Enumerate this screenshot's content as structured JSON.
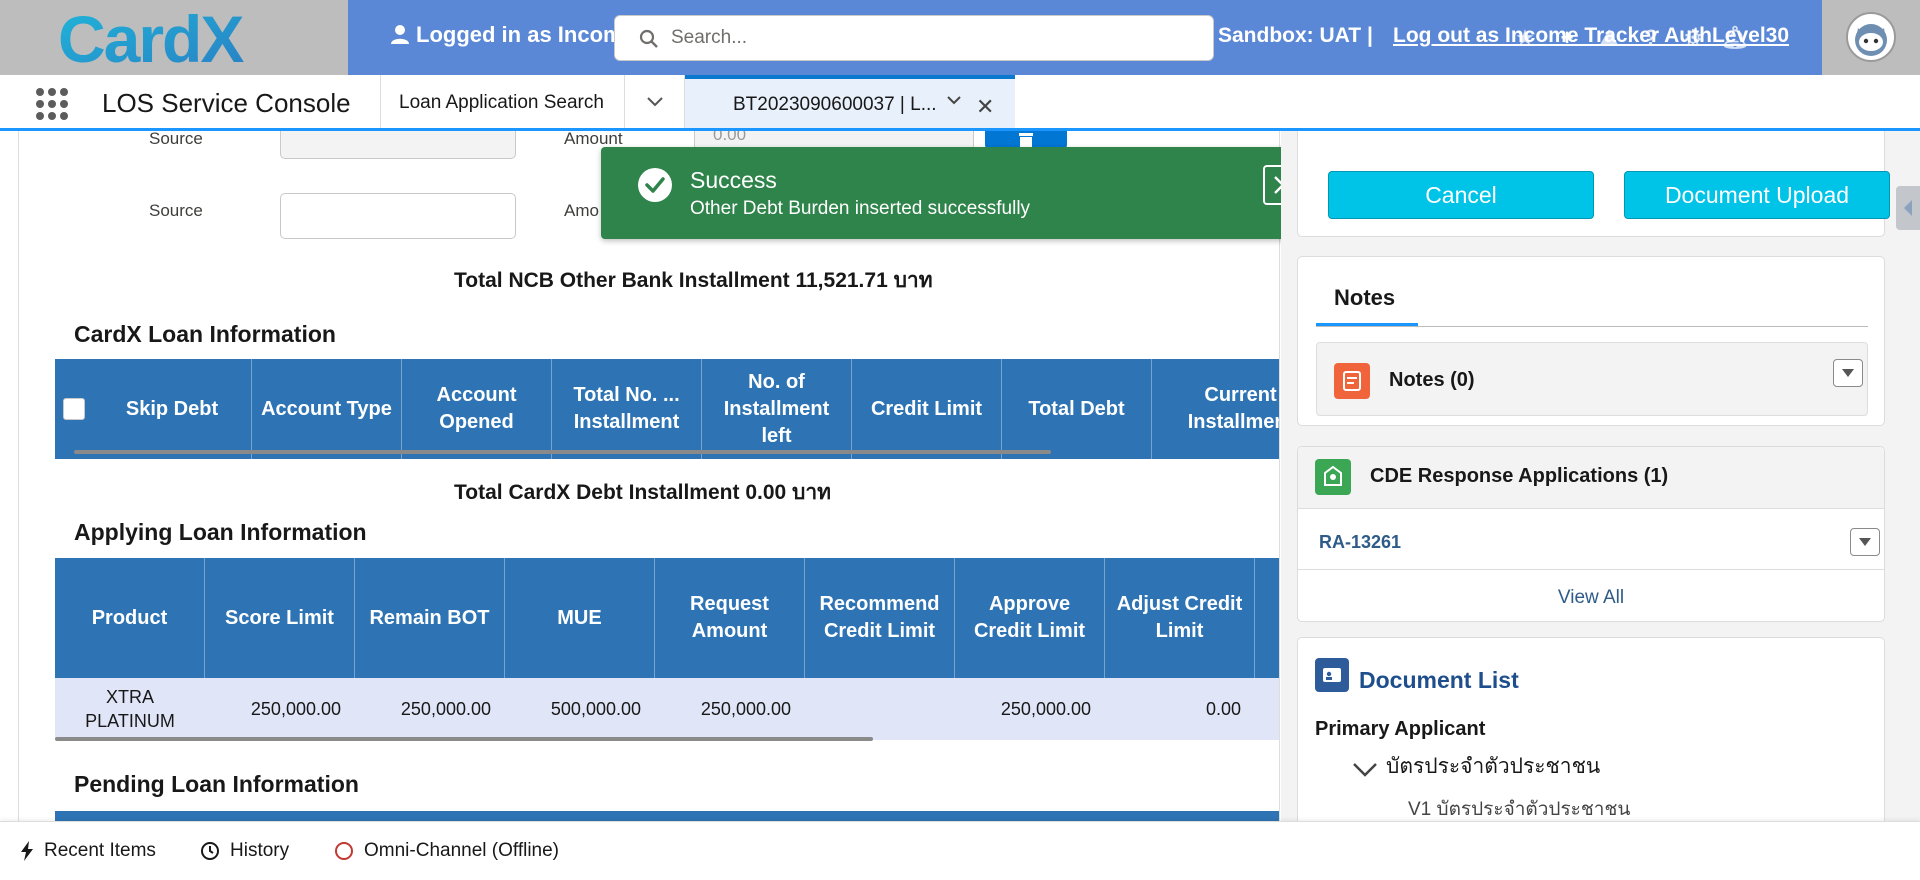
{
  "header": {
    "logo_text": "CardX",
    "logged_in_text": "Logged in as Income Tracker",
    "search_placeholder": "Search...",
    "sandbox_text": "Sandbox: UAT |",
    "logout_text": "Log out as Income Tracker AuthLevel30"
  },
  "nav": {
    "app_name": "LOS Service Console",
    "items": [
      {
        "label": "Loan Application Search"
      }
    ],
    "active_tab": {
      "label": "BT2023090600037 | L..."
    }
  },
  "form": {
    "source_label_1": "Source",
    "amount_label_1": "Amount",
    "amount_value_1": "0.00",
    "source_label_2": "Source",
    "amount_label_2": "Amo"
  },
  "totals": {
    "ncb_total": "Total NCB Other Bank Installment 11,521.71 บาท",
    "cardx_total": "Total CardX Debt Installment 0.00 บาท"
  },
  "cardx_loan": {
    "title": "CardX Loan Information",
    "columns": [
      "Skip Debt",
      "Account Type",
      "Account Opened",
      "Total No. ... Installment",
      "No. of Installment left",
      "Credit Limit",
      "Total Debt",
      "Current Installment"
    ]
  },
  "applying_loan": {
    "title": "Applying Loan Information",
    "columns": [
      "Product",
      "Score Limit",
      "Remain BOT",
      "MUE",
      "Request Amount",
      "Recommend Credit Limit",
      "Approve Credit Limit",
      "Adjust Credit Limit"
    ],
    "rows": [
      [
        "XTRA PLATINUM",
        "250,000.00",
        "250,000.00",
        "500,000.00",
        "250,000.00",
        "",
        "250,000.00",
        "0.00"
      ]
    ]
  },
  "pending_loan": {
    "title": "Pending Loan Information"
  },
  "toast": {
    "title": "Success",
    "message": "Other Debt Burden inserted successfully"
  },
  "sidebar": {
    "cancel_label": "Cancel",
    "upload_label": "Document Upload",
    "notes_tab": "Notes",
    "notes_item": "Notes (0)",
    "cde_title": "CDE Response Applications (1)",
    "cde_record": "RA-13261",
    "view_all": "View All",
    "doc_list_title": "Document List",
    "primary_applicant": "Primary Applicant",
    "doc_category": "บัตรประจำตัวประชาชน",
    "doc_sub": "V1 บัตรประจำตัวประชาชน"
  },
  "utility_bar": {
    "recent_items": "Recent Items",
    "history": "History",
    "omni_channel": "Omni-Channel (Offline)"
  },
  "colors": {
    "header_blue": "#5b88d6",
    "table_blue": "#2e74b5",
    "toast_green": "#2e844a",
    "button_cyan": "#00c3e8"
  }
}
